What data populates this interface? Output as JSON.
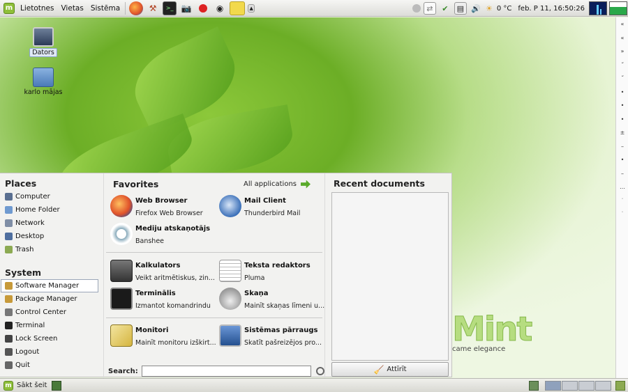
{
  "top_panel": {
    "menus": [
      "Lietotnes",
      "Vietas",
      "Sistēma"
    ],
    "temperature": "0 °C",
    "clock": "feb. P  11, 16:50:26"
  },
  "desktop": {
    "icons": [
      {
        "label": "Dators"
      },
      {
        "label": "karlo mājas"
      }
    ],
    "brand": {
      "logo_text": "Mint",
      "tagline": "came elegance"
    }
  },
  "menu": {
    "places_title": "Places",
    "places": [
      "Computer",
      "Home Folder",
      "Network",
      "Desktop",
      "Trash"
    ],
    "system_title": "System",
    "system": [
      "Software Manager",
      "Package Manager",
      "Control Center",
      "Terminal",
      "Lock Screen",
      "Logout",
      "Quit"
    ],
    "favorites_title": "Favorites",
    "all_applications": "All applications",
    "apps": [
      {
        "name": "Web Browser",
        "desc": "Firefox Web Browser"
      },
      {
        "name": "Mail Client",
        "desc": "Thunderbird Mail"
      },
      {
        "name": "Mediju atskaņotājs",
        "desc": "Banshee"
      },
      {
        "name": "Kalkulators",
        "desc": "Veikt aritmētiskus, zin..."
      },
      {
        "name": "Teksta redaktors",
        "desc": "Pluma"
      },
      {
        "name": "Terminālis",
        "desc": "Izmantot komandrindu"
      },
      {
        "name": "Skaņa",
        "desc": "Mainīt skaņas līmeni u..."
      },
      {
        "name": "Monitori",
        "desc": "Mainīt monitoru izškirt..."
      },
      {
        "name": "Sistēmas pārraugs",
        "desc": "Skatīt pašreizējos pro..."
      }
    ],
    "search_label": "Search:",
    "search_value": "",
    "recent_title": "Recent documents",
    "clear_label": "Attīrīt"
  },
  "bottom_panel": {
    "start_label": "Sākt šeit"
  },
  "right_strip": [
    "«",
    "«",
    "»",
    "˝",
    "˝",
    "•",
    "•",
    "•",
    "±",
    "–",
    "•",
    "–",
    "…",
    "˙",
    "˙"
  ],
  "colors": {
    "accent": "#8fbf3a",
    "panel": "#dcdcd8",
    "desktop": "#6cae26"
  }
}
